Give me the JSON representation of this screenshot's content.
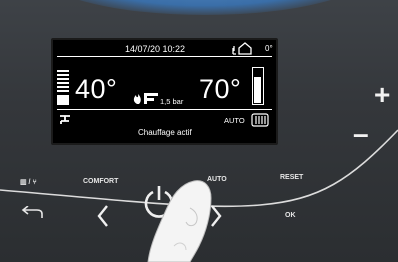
{
  "display": {
    "datetime": "14/07/20 10:22",
    "outdoor_temp": "0°",
    "heating_temp": "40°",
    "dhw_temp": "70°",
    "pressure": "1,5 bar",
    "mode": "AUTO",
    "status": "Chauffage actif",
    "heating_level": 0.3,
    "dhw_level": 0.75
  },
  "buttons": {
    "comfort_label": "COMFORT",
    "auto_label": "AUTO",
    "reset_label": "RESET",
    "ok_label": "OK",
    "mode_label": "▥ / ⑂",
    "plus": "+",
    "minus": "–"
  },
  "colors": {
    "accent_blue": "#3a6ea8",
    "display_bg": "#000000",
    "text": "#ffffff"
  }
}
